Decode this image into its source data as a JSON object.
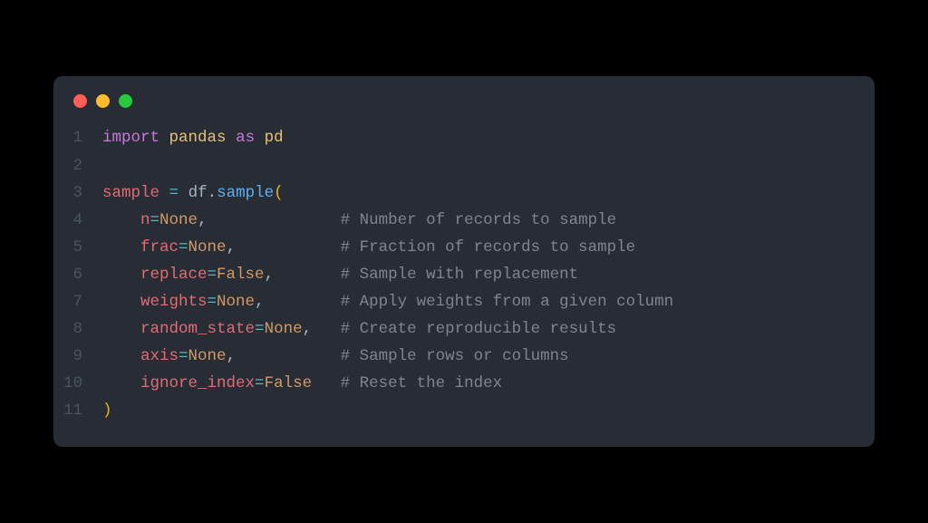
{
  "lines": [
    {
      "num": "1",
      "tokens": [
        {
          "cls": "keyword",
          "t": "import"
        },
        {
          "cls": "plain",
          "t": " "
        },
        {
          "cls": "module",
          "t": "pandas"
        },
        {
          "cls": "plain",
          "t": " "
        },
        {
          "cls": "keyword",
          "t": "as"
        },
        {
          "cls": "plain",
          "t": " "
        },
        {
          "cls": "module",
          "t": "pd"
        }
      ]
    },
    {
      "num": "2",
      "tokens": []
    },
    {
      "num": "3",
      "tokens": [
        {
          "cls": "variable",
          "t": "sample"
        },
        {
          "cls": "plain",
          "t": " "
        },
        {
          "cls": "operator",
          "t": "="
        },
        {
          "cls": "plain",
          "t": " "
        },
        {
          "cls": "plain",
          "t": "df"
        },
        {
          "cls": "dot",
          "t": "."
        },
        {
          "cls": "method",
          "t": "sample"
        },
        {
          "cls": "paren",
          "t": "("
        }
      ]
    },
    {
      "num": "4",
      "tokens": [
        {
          "cls": "plain",
          "t": "    "
        },
        {
          "cls": "param",
          "t": "n"
        },
        {
          "cls": "operator",
          "t": "="
        },
        {
          "cls": "none",
          "t": "None"
        },
        {
          "cls": "punct",
          "t": ","
        },
        {
          "cls": "plain",
          "t": "              "
        },
        {
          "cls": "comment",
          "t": "# Number of records to sample"
        }
      ]
    },
    {
      "num": "5",
      "tokens": [
        {
          "cls": "plain",
          "t": "    "
        },
        {
          "cls": "param",
          "t": "frac"
        },
        {
          "cls": "operator",
          "t": "="
        },
        {
          "cls": "none",
          "t": "None"
        },
        {
          "cls": "punct",
          "t": ","
        },
        {
          "cls": "plain",
          "t": "           "
        },
        {
          "cls": "comment",
          "t": "# Fraction of records to sample"
        }
      ]
    },
    {
      "num": "6",
      "tokens": [
        {
          "cls": "plain",
          "t": "    "
        },
        {
          "cls": "param",
          "t": "replace"
        },
        {
          "cls": "operator",
          "t": "="
        },
        {
          "cls": "false",
          "t": "False"
        },
        {
          "cls": "punct",
          "t": ","
        },
        {
          "cls": "plain",
          "t": "       "
        },
        {
          "cls": "comment",
          "t": "# Sample with replacement"
        }
      ]
    },
    {
      "num": "7",
      "tokens": [
        {
          "cls": "plain",
          "t": "    "
        },
        {
          "cls": "param",
          "t": "weights"
        },
        {
          "cls": "operator",
          "t": "="
        },
        {
          "cls": "none",
          "t": "None"
        },
        {
          "cls": "punct",
          "t": ","
        },
        {
          "cls": "plain",
          "t": "        "
        },
        {
          "cls": "comment",
          "t": "# Apply weights from a given column"
        }
      ]
    },
    {
      "num": "8",
      "tokens": [
        {
          "cls": "plain",
          "t": "    "
        },
        {
          "cls": "param",
          "t": "random_state"
        },
        {
          "cls": "operator",
          "t": "="
        },
        {
          "cls": "none",
          "t": "None"
        },
        {
          "cls": "punct",
          "t": ","
        },
        {
          "cls": "plain",
          "t": "   "
        },
        {
          "cls": "comment",
          "t": "# Create reproducible results"
        }
      ]
    },
    {
      "num": "9",
      "tokens": [
        {
          "cls": "plain",
          "t": "    "
        },
        {
          "cls": "param",
          "t": "axis"
        },
        {
          "cls": "operator",
          "t": "="
        },
        {
          "cls": "none",
          "t": "None"
        },
        {
          "cls": "punct",
          "t": ","
        },
        {
          "cls": "plain",
          "t": "           "
        },
        {
          "cls": "comment",
          "t": "# Sample rows or columns"
        }
      ]
    },
    {
      "num": "10",
      "tokens": [
        {
          "cls": "plain",
          "t": "    "
        },
        {
          "cls": "param",
          "t": "ignore_index"
        },
        {
          "cls": "operator",
          "t": "="
        },
        {
          "cls": "false",
          "t": "False"
        },
        {
          "cls": "plain",
          "t": "   "
        },
        {
          "cls": "comment",
          "t": "# Reset the index"
        }
      ]
    },
    {
      "num": "11",
      "tokens": [
        {
          "cls": "paren",
          "t": ")"
        }
      ]
    }
  ]
}
